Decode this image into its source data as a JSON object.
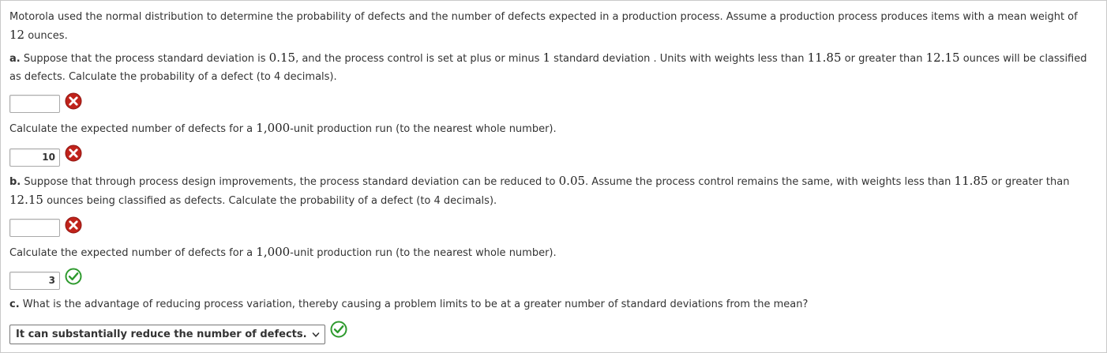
{
  "intro": {
    "t1": "Motorola used the normal distribution to determine the probability of defects and the number of defects expected in a production process. Assume a production process produces items with a mean weight of ",
    "mean": "12",
    "t2": " ounces."
  },
  "part_a": {
    "letter": "a.",
    "t1": " Suppose that the process standard deviation is ",
    "sd": "0.15",
    "t2": ", and the process control is set at plus or minus ",
    "k": "1",
    "t3": " standard deviation . Units with weights less than ",
    "low": "11.85",
    "t4": " or greater than ",
    "high": "12.15",
    "t5": " ounces will be classified as defects. Calculate the probability of a defect (to 4 decimals).",
    "answer1": {
      "value": "",
      "status": "incorrect"
    },
    "q2": {
      "t1": "Calculate the expected number of defects for a ",
      "units": "1,000",
      "t2": "-unit production run (to the nearest whole number)."
    },
    "answer2": {
      "value": "10",
      "status": "incorrect"
    }
  },
  "part_b": {
    "letter": "b.",
    "t1": " Suppose that through process design improvements, the process standard deviation can be reduced to ",
    "sd": "0.05",
    "t2": ". Assume the process control remains the same, with weights less than ",
    "low": "11.85",
    "t3": " or greater than ",
    "high": "12.15",
    "t4": " ounces being classified as defects. Calculate the probability of a defect (to 4 decimals).",
    "answer1": {
      "value": "",
      "status": "incorrect"
    },
    "q2": {
      "t1": "Calculate the expected number of defects for a ",
      "units": "1,000",
      "t2": "-unit production run (to the nearest whole number)."
    },
    "answer2": {
      "value": "3",
      "status": "correct"
    }
  },
  "part_c": {
    "letter": "c.",
    "t1": " What is the advantage of reducing process variation, thereby causing a problem limits to be at a greater number of standard deviations from the mean?",
    "selected": "It can substantially reduce the number of defects.",
    "status": "correct"
  },
  "colors": {
    "incorrect": "#c0231b",
    "correct": "#2e9a2e"
  }
}
